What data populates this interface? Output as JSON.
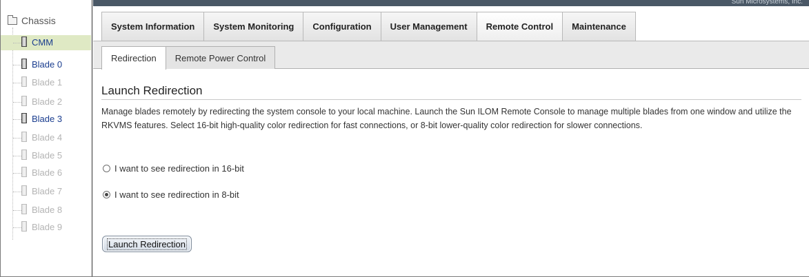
{
  "brand": {
    "text": "Sun Microsystems, Inc."
  },
  "sidebar": {
    "root_label": "Chassis",
    "items": [
      {
        "label": "CMM",
        "enabled": true,
        "selected": true
      },
      {
        "label": "Blade 0",
        "enabled": true,
        "selected": false
      },
      {
        "label": "Blade 1",
        "enabled": false,
        "selected": false
      },
      {
        "label": "Blade 2",
        "enabled": false,
        "selected": false
      },
      {
        "label": "Blade 3",
        "enabled": true,
        "selected": false
      },
      {
        "label": "Blade 4",
        "enabled": false,
        "selected": false
      },
      {
        "label": "Blade 5",
        "enabled": false,
        "selected": false
      },
      {
        "label": "Blade 6",
        "enabled": false,
        "selected": false
      },
      {
        "label": "Blade 7",
        "enabled": false,
        "selected": false
      },
      {
        "label": "Blade 8",
        "enabled": false,
        "selected": false
      },
      {
        "label": "Blade 9",
        "enabled": false,
        "selected": false
      }
    ]
  },
  "main_tabs": [
    {
      "label": "System Information",
      "active": false
    },
    {
      "label": "System Monitoring",
      "active": false
    },
    {
      "label": "Configuration",
      "active": false
    },
    {
      "label": "User Management",
      "active": false
    },
    {
      "label": "Remote Control",
      "active": true
    },
    {
      "label": "Maintenance",
      "active": false
    }
  ],
  "sub_tabs": [
    {
      "label": "Redirection",
      "active": true
    },
    {
      "label": "Remote Power Control",
      "active": false
    }
  ],
  "content": {
    "title": "Launch Redirection",
    "description": "Manage blades remotely by redirecting the system console to your local machine. Launch the Sun ILOM Remote Console to manage multiple blades from one window and utilize the RKVMS features. Select 16-bit high-quality color redirection for fast connections, or 8-bit lower-quality color redirection for slower connections.",
    "options": [
      {
        "label": "I want to see redirection in 16-bit",
        "checked": false
      },
      {
        "label": "I want to see redirection in 8-bit",
        "checked": true
      }
    ],
    "launch_button": "Launch Redirection"
  }
}
